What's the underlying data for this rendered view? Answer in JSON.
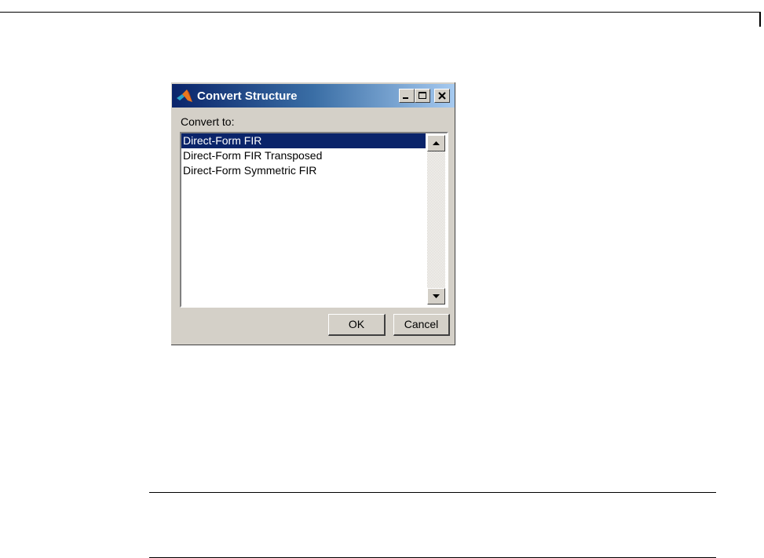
{
  "dialog": {
    "title": "Convert Structure",
    "title_buttons": [
      "minimize-icon",
      "maximize-icon",
      "close-icon"
    ],
    "label": "Convert to:",
    "options": [
      {
        "label": "Direct-Form FIR",
        "selected": true
      },
      {
        "label": "Direct-Form FIR Transposed",
        "selected": false
      },
      {
        "label": "Direct-Form Symmetric FIR",
        "selected": false
      }
    ],
    "ok_label": "OK",
    "cancel_label": "Cancel"
  },
  "colors": {
    "titlebar_start": "#0a246a",
    "titlebar_end": "#a6caf0",
    "selection": "#0a246a",
    "dialog_face": "#d4d0c8"
  }
}
